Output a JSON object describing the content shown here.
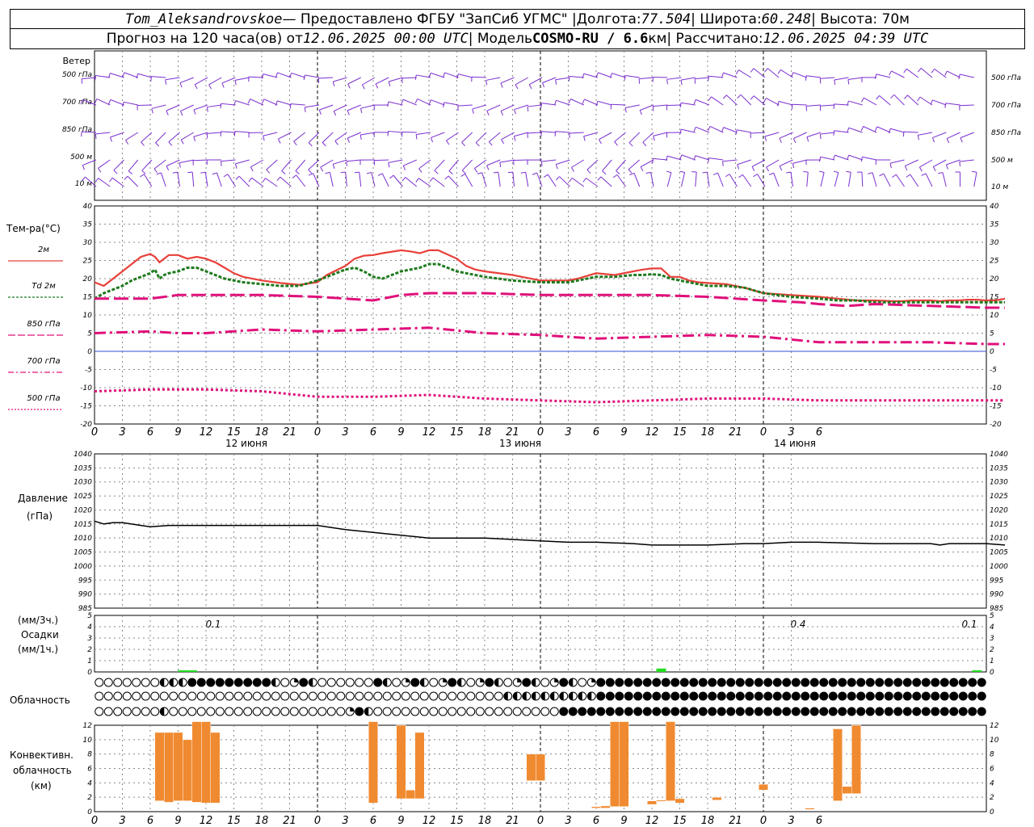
{
  "header": {
    "station": "Tom_Aleksandrovskoe",
    "provider": " — Предоставлено ФГБУ \"ЗапСиб УГМС\" | ",
    "lon_label": "Долгота: ",
    "lon": "77.504",
    "lat_label": " | Широта: ",
    "lat": "60.248",
    "alt_label": " | Высота: 70м",
    "forecast_label": "Прогноз на 120 часа(ов) от ",
    "forecast_from": "12.06.2025 00:00 UTC",
    "model_label": "  | Модель ",
    "model": "COSMO-RU / 6.6",
    "model_unit": "км",
    "calc_label": " | Рассчитано: ",
    "calc_time": "12.06.2025 04:39 UTC"
  },
  "wind_panel": {
    "title": "Ветер",
    "levels": [
      "500 гПа",
      "700 гПа",
      "850 гПа",
      "500 м",
      "10  м"
    ]
  },
  "temp_panel": {
    "title": "Тем-ра(°C)",
    "legend": [
      {
        "label": "2м",
        "color": "#e8403a"
      },
      {
        "label": "Td  2м",
        "color": "#1e7a1e"
      },
      {
        "label": "850 гПа",
        "color": "#e0107a"
      },
      {
        "label": "700 гПа",
        "color": "#e0107a"
      },
      {
        "label": "500 гПа",
        "color": "#e0107a"
      }
    ]
  },
  "pressure_panel": {
    "title": "Давление",
    "unit": "(гПа)"
  },
  "precip_panel": {
    "unit_3h": "(мм/3ч.)",
    "title": "Осадки",
    "unit_1h": "(мм/1ч.)",
    "totals": [
      "0.1",
      "0.4",
      "0.1"
    ]
  },
  "cloud_panel": {
    "title": "Облачность"
  },
  "conv_panel": {
    "title1": "Конвективн.",
    "title2": "облачность",
    "unit": "(км)"
  },
  "time_axis": {
    "ticks": [
      "0",
      "3",
      "6",
      "9",
      "12",
      "15",
      "18",
      "21",
      "0",
      "3",
      "6",
      "9",
      "12",
      "15",
      "18",
      "21",
      "0",
      "3",
      "6",
      "9",
      "12",
      "15",
      "18",
      "21",
      "0",
      "3",
      "6"
    ],
    "dates": [
      "12 июня",
      "13 июня",
      "14 июня"
    ]
  },
  "chart_data": [
    {
      "type": "line",
      "title": "Тем-ра(°C)",
      "x_unit": "hours from 12.06.2025 00 UTC",
      "ylim": [
        -20,
        40
      ],
      "series": [
        {
          "name": "2м",
          "color": "#e8403a",
          "x": [
            0,
            1,
            2,
            3,
            4,
            5,
            6,
            6.5,
            7,
            7.5,
            8,
            9,
            10,
            11,
            12,
            13,
            14,
            15,
            16,
            18,
            20,
            22,
            24,
            25,
            27,
            28,
            29,
            30,
            31,
            33,
            34,
            35,
            36,
            37,
            39,
            40,
            41,
            42,
            45,
            48,
            51,
            52,
            54,
            56,
            58,
            59,
            60,
            61,
            62,
            63,
            64,
            65,
            66,
            68,
            70,
            72,
            75,
            78,
            80,
            82,
            84,
            86,
            87,
            88,
            90,
            91,
            92,
            93,
            94,
            95,
            96,
            97,
            98
          ],
          "y": [
            19,
            18,
            20,
            22,
            24,
            26,
            26.8,
            26,
            24.5,
            25.5,
            26.5,
            26.5,
            25.5,
            26,
            25.5,
            24.5,
            23,
            21.5,
            20.5,
            19.5,
            18.8,
            18.3,
            19,
            21,
            23.5,
            25.5,
            26.3,
            26.5,
            27,
            27.8,
            27.5,
            27,
            27.8,
            27.8,
            25.5,
            23.5,
            22.5,
            22,
            21,
            19.5,
            19.5,
            20,
            21.5,
            21,
            22,
            22.5,
            22.8,
            22.8,
            20.5,
            20.5,
            19.5,
            19,
            18.8,
            18.5,
            17.5,
            16,
            15.5,
            15,
            14.5,
            14,
            14,
            13.8,
            13.8,
            14,
            14,
            13.8,
            14,
            14,
            14.2,
            14.2,
            14,
            14,
            14.5
          ]
        },
        {
          "name": "Td 2м",
          "color": "#1e7a1e",
          "x": [
            0,
            1,
            2,
            3,
            4,
            5,
            6,
            6.5,
            7,
            7.5,
            8,
            9,
            10,
            11,
            12,
            13,
            14,
            15,
            16,
            18,
            20,
            22,
            24,
            25,
            27,
            28,
            29,
            30,
            31,
            33,
            34,
            35,
            36,
            37,
            39,
            40,
            41,
            42,
            45,
            48,
            51,
            52,
            54,
            56,
            58,
            59,
            60,
            61,
            62,
            63,
            64,
            65,
            66,
            68,
            70,
            72,
            75,
            78,
            80,
            82,
            84,
            86,
            87,
            88,
            90,
            91,
            92,
            93,
            94,
            95,
            96,
            97,
            98
          ],
          "y": [
            14.5,
            16,
            17,
            18,
            19.5,
            20.5,
            21.5,
            22.5,
            20,
            21,
            21.5,
            22,
            23,
            23,
            22,
            21,
            20,
            19.5,
            19,
            18.5,
            18,
            18,
            19.5,
            20.5,
            22.5,
            23,
            22,
            20.5,
            20,
            22,
            22.5,
            23,
            24,
            24,
            22,
            21.5,
            21,
            20.5,
            19.5,
            19,
            19,
            19.5,
            20.5,
            20.5,
            21,
            21,
            21.2,
            21,
            20,
            19.5,
            19,
            18.5,
            18,
            18,
            17.5,
            16,
            15,
            14.5,
            14,
            14,
            13.5,
            13.5,
            13.5,
            13.5,
            13.5,
            13.5,
            13.5,
            13.5,
            13.5,
            13.5,
            13.5,
            13.5,
            13.5
          ]
        },
        {
          "name": "850 гПа",
          "color": "#e0107a",
          "x": [
            0,
            6,
            9,
            12,
            18,
            24,
            30,
            33,
            36,
            42,
            48,
            54,
            60,
            66,
            72,
            76,
            78,
            81,
            84,
            90,
            96,
            98
          ],
          "y": [
            14.5,
            14.5,
            15.5,
            15.5,
            15.5,
            15,
            14,
            15.5,
            16,
            16,
            15.5,
            15.5,
            15.5,
            15,
            14,
            13.5,
            13,
            12.5,
            13,
            12.5,
            12,
            12
          ]
        },
        {
          "name": "700 гПа",
          "color": "#e0107a",
          "x": [
            0,
            6,
            9,
            12,
            18,
            24,
            30,
            36,
            42,
            48,
            54,
            60,
            66,
            72,
            78,
            84,
            90,
            96,
            98
          ],
          "y": [
            5,
            5.5,
            5,
            5,
            6,
            5.5,
            6,
            6.5,
            5,
            4.5,
            3.5,
            4,
            4.5,
            4,
            2.5,
            2.5,
            2.5,
            2,
            2
          ]
        },
        {
          "name": "500 гПа",
          "color": "#e0107a",
          "x": [
            0,
            6,
            12,
            18,
            24,
            30,
            36,
            42,
            48,
            54,
            60,
            66,
            72,
            78,
            84,
            90,
            96,
            98
          ],
          "y": [
            -11,
            -10.5,
            -10.5,
            -11,
            -12.5,
            -12.5,
            -12,
            -13,
            -13.5,
            -14,
            -13.5,
            -13,
            -13,
            -13.5,
            -13.5,
            -13.5,
            -13.5,
            -13.5
          ]
        }
      ]
    },
    {
      "type": "line",
      "title": "Давление",
      "ylabel": "(гПа)",
      "ylim": [
        985,
        1040
      ],
      "series": [
        {
          "x": [
            0,
            1,
            2,
            3,
            5,
            6,
            8,
            12,
            18,
            24,
            27,
            30,
            33,
            36,
            42,
            48,
            51,
            54,
            58,
            60,
            63,
            66,
            70,
            72,
            75,
            78,
            84,
            90,
            91,
            92,
            96,
            98
          ],
          "y": [
            1016,
            1015,
            1015.5,
            1015.5,
            1014.5,
            1014,
            1014.5,
            1014.5,
            1014.5,
            1014.5,
            1013,
            1012,
            1011,
            1010,
            1010,
            1009,
            1008.5,
            1008.5,
            1008,
            1007.5,
            1007.5,
            1007.5,
            1008,
            1008,
            1008.5,
            1008.5,
            1008,
            1008,
            1007.5,
            1008,
            1008,
            1007.5
          ]
        }
      ]
    },
    {
      "type": "bar",
      "title": "Осадки",
      "ylim": [
        0,
        5
      ],
      "x": [
        9.5,
        10.5,
        61,
        95
      ],
      "values": [
        0.05,
        0.05,
        0.3,
        0.15
      ]
    },
    {
      "type": "bar",
      "title": "Конвективн. облачность",
      "ylabel": "(км)",
      "ylim": [
        0,
        13
      ],
      "bars": [
        {
          "x": 7,
          "base": 1.5,
          "top": 11
        },
        {
          "x": 8,
          "base": 1.3,
          "top": 11
        },
        {
          "x": 9,
          "base": 1.5,
          "top": 11
        },
        {
          "x": 10,
          "base": 1.5,
          "top": 10
        },
        {
          "x": 11,
          "base": 1.3,
          "top": 12.5
        },
        {
          "x": 12,
          "base": 1.2,
          "top": 12.5
        },
        {
          "x": 13,
          "base": 1.2,
          "top": 11
        },
        {
          "x": 30,
          "base": 1.2,
          "top": 12.5
        },
        {
          "x": 33,
          "base": 1.8,
          "top": 12
        },
        {
          "x": 34,
          "base": 1.8,
          "top": 3
        },
        {
          "x": 35,
          "base": 1.8,
          "top": 11
        },
        {
          "x": 47,
          "base": 4.3,
          "top": 8
        },
        {
          "x": 48,
          "base": 4.3,
          "top": 8
        },
        {
          "x": 54,
          "base": 0.5,
          "top": 0.7
        },
        {
          "x": 55,
          "base": 0.5,
          "top": 0.8
        },
        {
          "x": 56,
          "base": 0.7,
          "top": 12.5
        },
        {
          "x": 57,
          "base": 0.7,
          "top": 12.5
        },
        {
          "x": 60,
          "base": 1,
          "top": 1.5
        },
        {
          "x": 61,
          "base": 1.5,
          "top": 1.6
        },
        {
          "x": 62,
          "base": 1.5,
          "top": 12.5
        },
        {
          "x": 63,
          "base": 1.2,
          "top": 1.8
        },
        {
          "x": 67,
          "base": 1.6,
          "top": 2
        },
        {
          "x": 72,
          "base": 3,
          "top": 3.8
        },
        {
          "x": 77,
          "base": 0.3,
          "top": 0.5
        },
        {
          "x": 80,
          "base": 1.5,
          "top": 11.5
        },
        {
          "x": 81,
          "base": 2.5,
          "top": 3.5
        },
        {
          "x": 82,
          "base": 2.5,
          "top": 12
        }
      ]
    }
  ]
}
